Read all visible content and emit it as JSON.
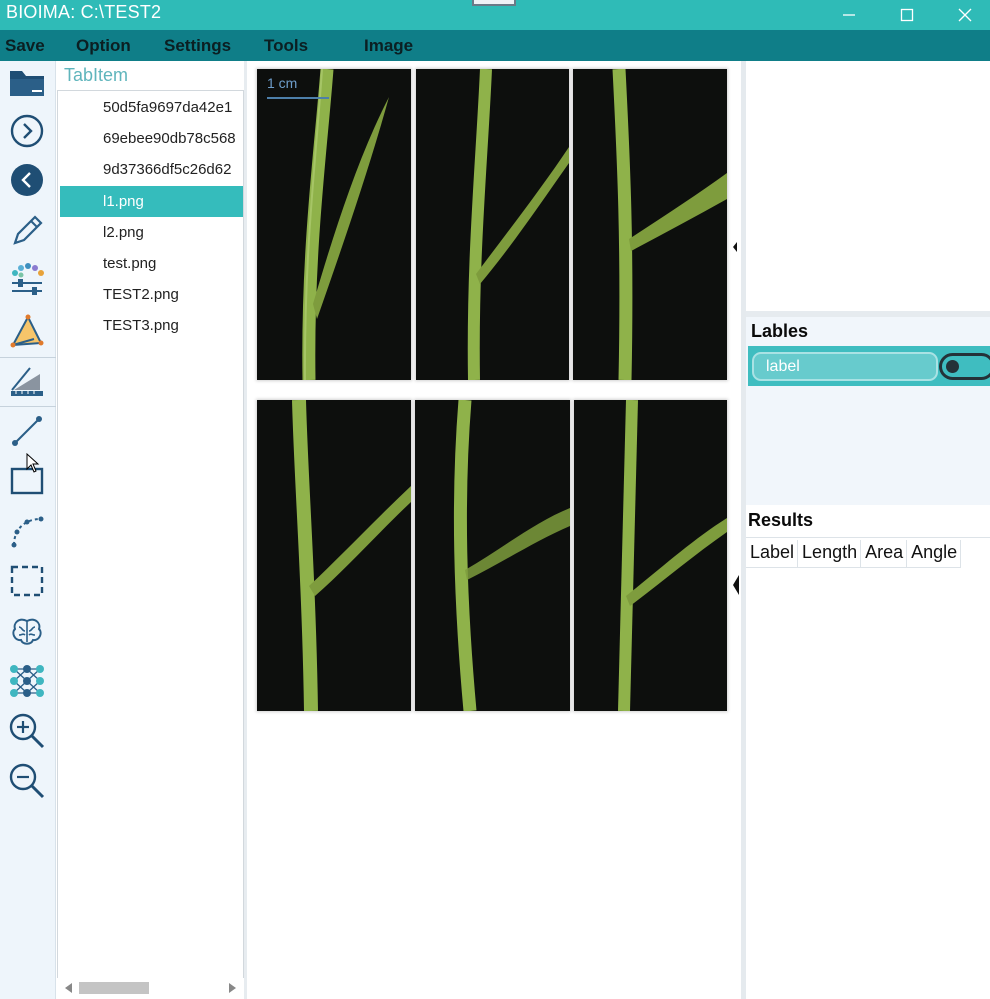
{
  "window": {
    "title": "BIOIMA: C:\\TEST2"
  },
  "menu": [
    {
      "label": "Save"
    },
    {
      "label": "Option"
    },
    {
      "label": "Settings"
    },
    {
      "label": "Tools"
    },
    {
      "label": "Image"
    }
  ],
  "toolbar": {
    "icons": [
      "open-folder-icon",
      "next-icon",
      "previous-icon",
      "pencil-icon",
      "color-adjust-icon",
      "triangle-measure-icon",
      "protractor-icon",
      "line-icon",
      "rectangle-icon",
      "curve-icon",
      "selection-icon",
      "brain-icon",
      "neural-network-icon",
      "zoom-in-icon",
      "zoom-out-icon"
    ]
  },
  "file_panel": {
    "tab_label": "TabItem",
    "files": [
      {
        "name": "50d5fa9697da42e1",
        "selected": false
      },
      {
        "name": "69ebee90db78c568",
        "selected": false
      },
      {
        "name": "9d37366df5c26d62",
        "selected": false
      },
      {
        "name": "l1.png",
        "selected": true
      },
      {
        "name": "l2.png",
        "selected": false
      },
      {
        "name": "test.png",
        "selected": false
      },
      {
        "name": "TEST2.png",
        "selected": false
      },
      {
        "name": "TEST3.png",
        "selected": false
      }
    ]
  },
  "canvas": {
    "scale_label": "1 cm"
  },
  "labels_panel": {
    "title": "Lables",
    "items": [
      {
        "name": "label",
        "enabled": false
      }
    ]
  },
  "results_panel": {
    "title": "Results",
    "columns": [
      "Label",
      "Length",
      "Area",
      "Angle"
    ]
  },
  "colors": {
    "titlebar": "#2fbbb7",
    "menubar": "#0f7e88",
    "selection": "#35bcbc",
    "plant": "#8fb24a"
  }
}
